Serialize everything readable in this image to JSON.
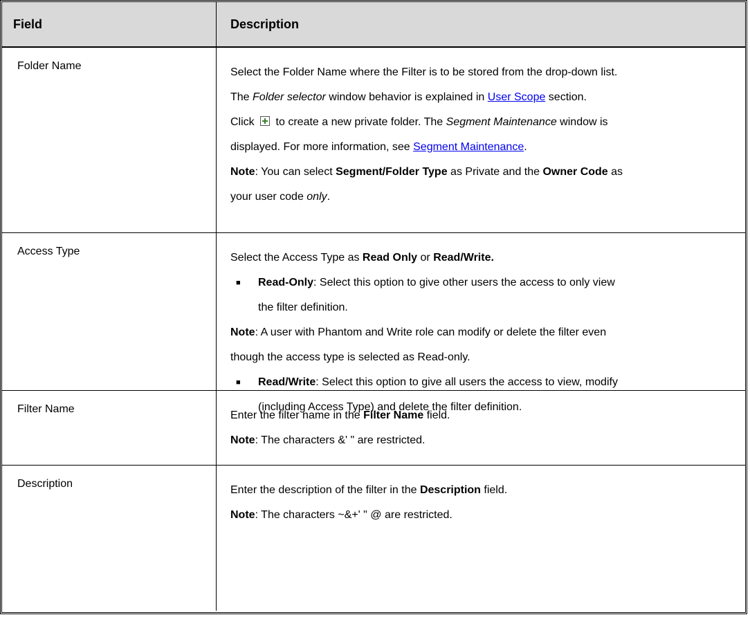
{
  "header": {
    "col1": "Field",
    "col2": "Description"
  },
  "rows": {
    "folder": {
      "field": "Folder Name",
      "line1": "Select the Folder Name where the Filter is to be stored from the drop-down list.",
      "line2_pre": "The ",
      "line2_em": "Folder selector",
      "line2_mid": " window behavior is explained in ",
      "line2_link": "User Scope",
      "line2_post": " section.",
      "line3_pre": "Click ",
      "line3_mid": " to create a new private folder. The ",
      "line3_em": "Segment Maintenance",
      "line3_post": " window is",
      "line4_pre": "displayed. For more information, see ",
      "line4_link": "Segment Maintenance",
      "line4_post": ".",
      "note_label": "Note",
      "note_a": ": You can select ",
      "note_b": "Segment/Folder Type",
      "note_c": " as Private and the ",
      "note_d": "Owner Code",
      "note_e": " as",
      "note_f": "your user code ",
      "note_g": "only",
      "note_h": "."
    },
    "access": {
      "field": "Access Type",
      "line1_pre": "Select the Access Type as ",
      "line1_b1": "Read Only",
      "line1_mid": " or ",
      "line1_b2": "Read/Write.",
      "b1_label": "Read-Only",
      "b1_text": ": Select this option to give other users the access to only view",
      "b1_text2": "the filter definition.",
      "note_label": "Note",
      "note_text": ": A user with Phantom and Write role can modify or delete the filter even",
      "note_text2": "though the access type is selected as Read-only.",
      "b2_label": "Read/Write",
      "b2_text": ": Select this option to give all users the access to view, modify",
      "b2_text2": "(including Access Type) and delete the filter definition."
    },
    "filter": {
      "field": "Filter Name",
      "line1_pre": "Enter the filter name in the ",
      "line1_b": "Filter Name",
      "line1_post": " field.",
      "note_label": "Note",
      "note_text": ": The characters &' \" are restricted."
    },
    "description": {
      "field": "Description",
      "line1_pre": "Enter the description of the filter in the ",
      "line1_b": "Description",
      "line1_post": " field.",
      "note_label": "Note",
      "note_text": ": The characters ~&+' \" @ are restricted."
    }
  },
  "icons": {
    "new_folder": "new-folder-icon",
    "bullet": "square-bullet"
  }
}
